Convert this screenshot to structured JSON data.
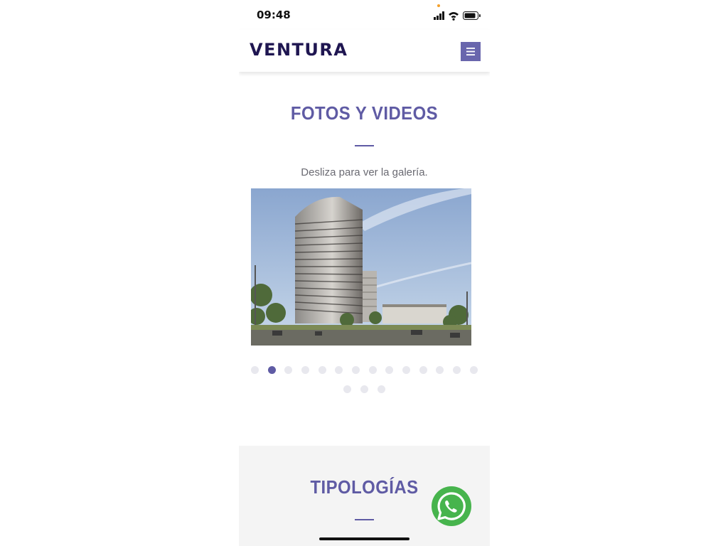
{
  "status_bar": {
    "time": "09:48",
    "icons": [
      "signal-icon",
      "wifi-icon",
      "battery-icon"
    ]
  },
  "header": {
    "logo_text": "VENTURA",
    "menu_icon": "hamburger-menu-icon"
  },
  "gallery": {
    "title": "FOTOS Y VIDEOS",
    "subtitle": "Desliza para ver la galería.",
    "image_subject": "building-rendering",
    "total_slides": 17,
    "active_slide": 2
  },
  "tipologias": {
    "title": "TIPOLOGÍAS"
  },
  "floating": {
    "whatsapp_icon": "whatsapp-icon"
  },
  "colors": {
    "brand_dark": "#1f1651",
    "accent": "#5f5ba4",
    "menu_button": "#6966ad",
    "whatsapp_green": "#47b44d"
  }
}
